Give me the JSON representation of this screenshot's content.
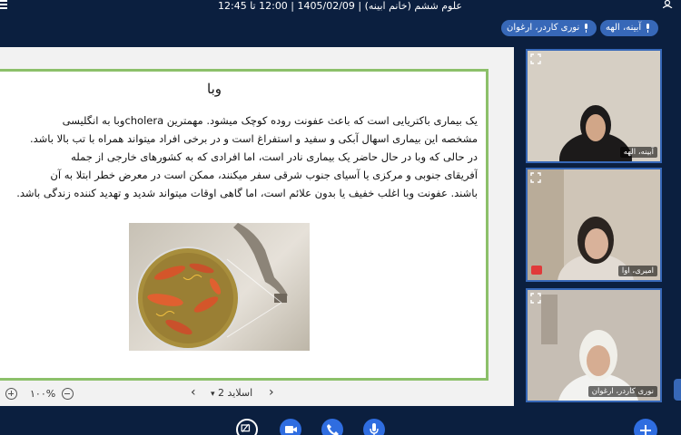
{
  "header": {
    "title": "علوم ششم (خانم ابینه) | 1405/02/09 | 12:00 تا 12:45",
    "chips": [
      {
        "label": "نوری کاردر، ارغوان"
      },
      {
        "label": "آبینه، الهه"
      }
    ]
  },
  "slide": {
    "title": "وبا",
    "lines": [
      "یک بیماری باکتریایی است که باعث عفونت روده کوچک میشود. مهمترین choleraوبا به انگلیسی",
      "مشخصه این بیماری اسهال آبکی و سفید و استفراغ است و در برخی افراد میتواند همراه با تب بالا باشد.",
      "در حالی که وبا در حال حاضر یک بیماری نادر است، اما افرادی که به کشورهای خارجی از جمله",
      "آفریقای جنوبی و مرکزی یا آسیای جنوب شرقی سفر میکنند، ممکن است در معرض خطر ابتلا به آن",
      "باشند. عفونت وبا اغلب خفیف یا بدون علائم است، اما گاهی اوقات میتواند شدید و تهدید کننده زندگی باشد."
    ]
  },
  "controls": {
    "zoom": "۱۰۰%",
    "slide_label": "اسلاید 2"
  },
  "tiles": [
    {
      "name": "آبینه، الهه"
    },
    {
      "name": "اميری، اوا"
    },
    {
      "name": "نوری کاردر، ارغوان"
    }
  ],
  "colors": {
    "background": "#0b1f3f",
    "accent": "#3768b8",
    "slide_border": "#8cc06a",
    "button": "#2f6de0"
  }
}
